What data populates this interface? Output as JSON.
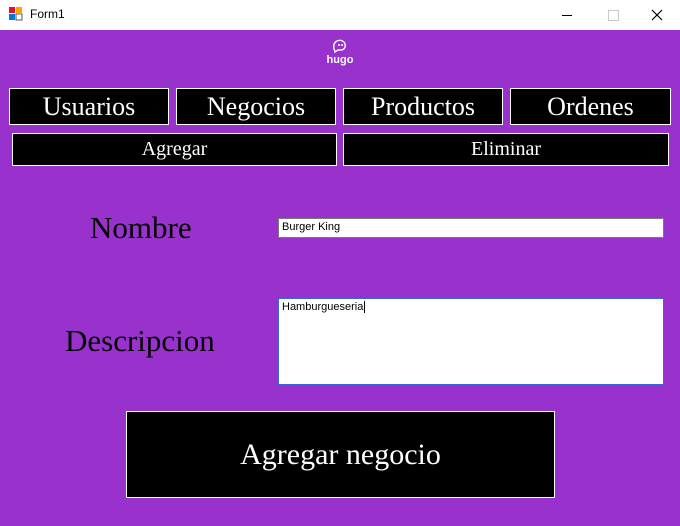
{
  "window": {
    "title": "Form1",
    "minimize": "minimize",
    "maximize": "maximize",
    "close": "close"
  },
  "logo": {
    "text": "hugo"
  },
  "nav": {
    "items": [
      {
        "label": "Usuarios"
      },
      {
        "label": "Negocios"
      },
      {
        "label": "Productos"
      },
      {
        "label": "Ordenes"
      }
    ]
  },
  "actions": {
    "add_label": "Agregar",
    "delete_label": "Eliminar"
  },
  "form": {
    "name_label": "Nombre",
    "name_value": "Burger King",
    "description_label": "Descripcion",
    "description_value": "Hamburgueseria",
    "submit_label": "Agregar negocio"
  },
  "colors": {
    "background": "#9932cc",
    "button_bg": "#000000",
    "button_text": "#ffffff"
  }
}
